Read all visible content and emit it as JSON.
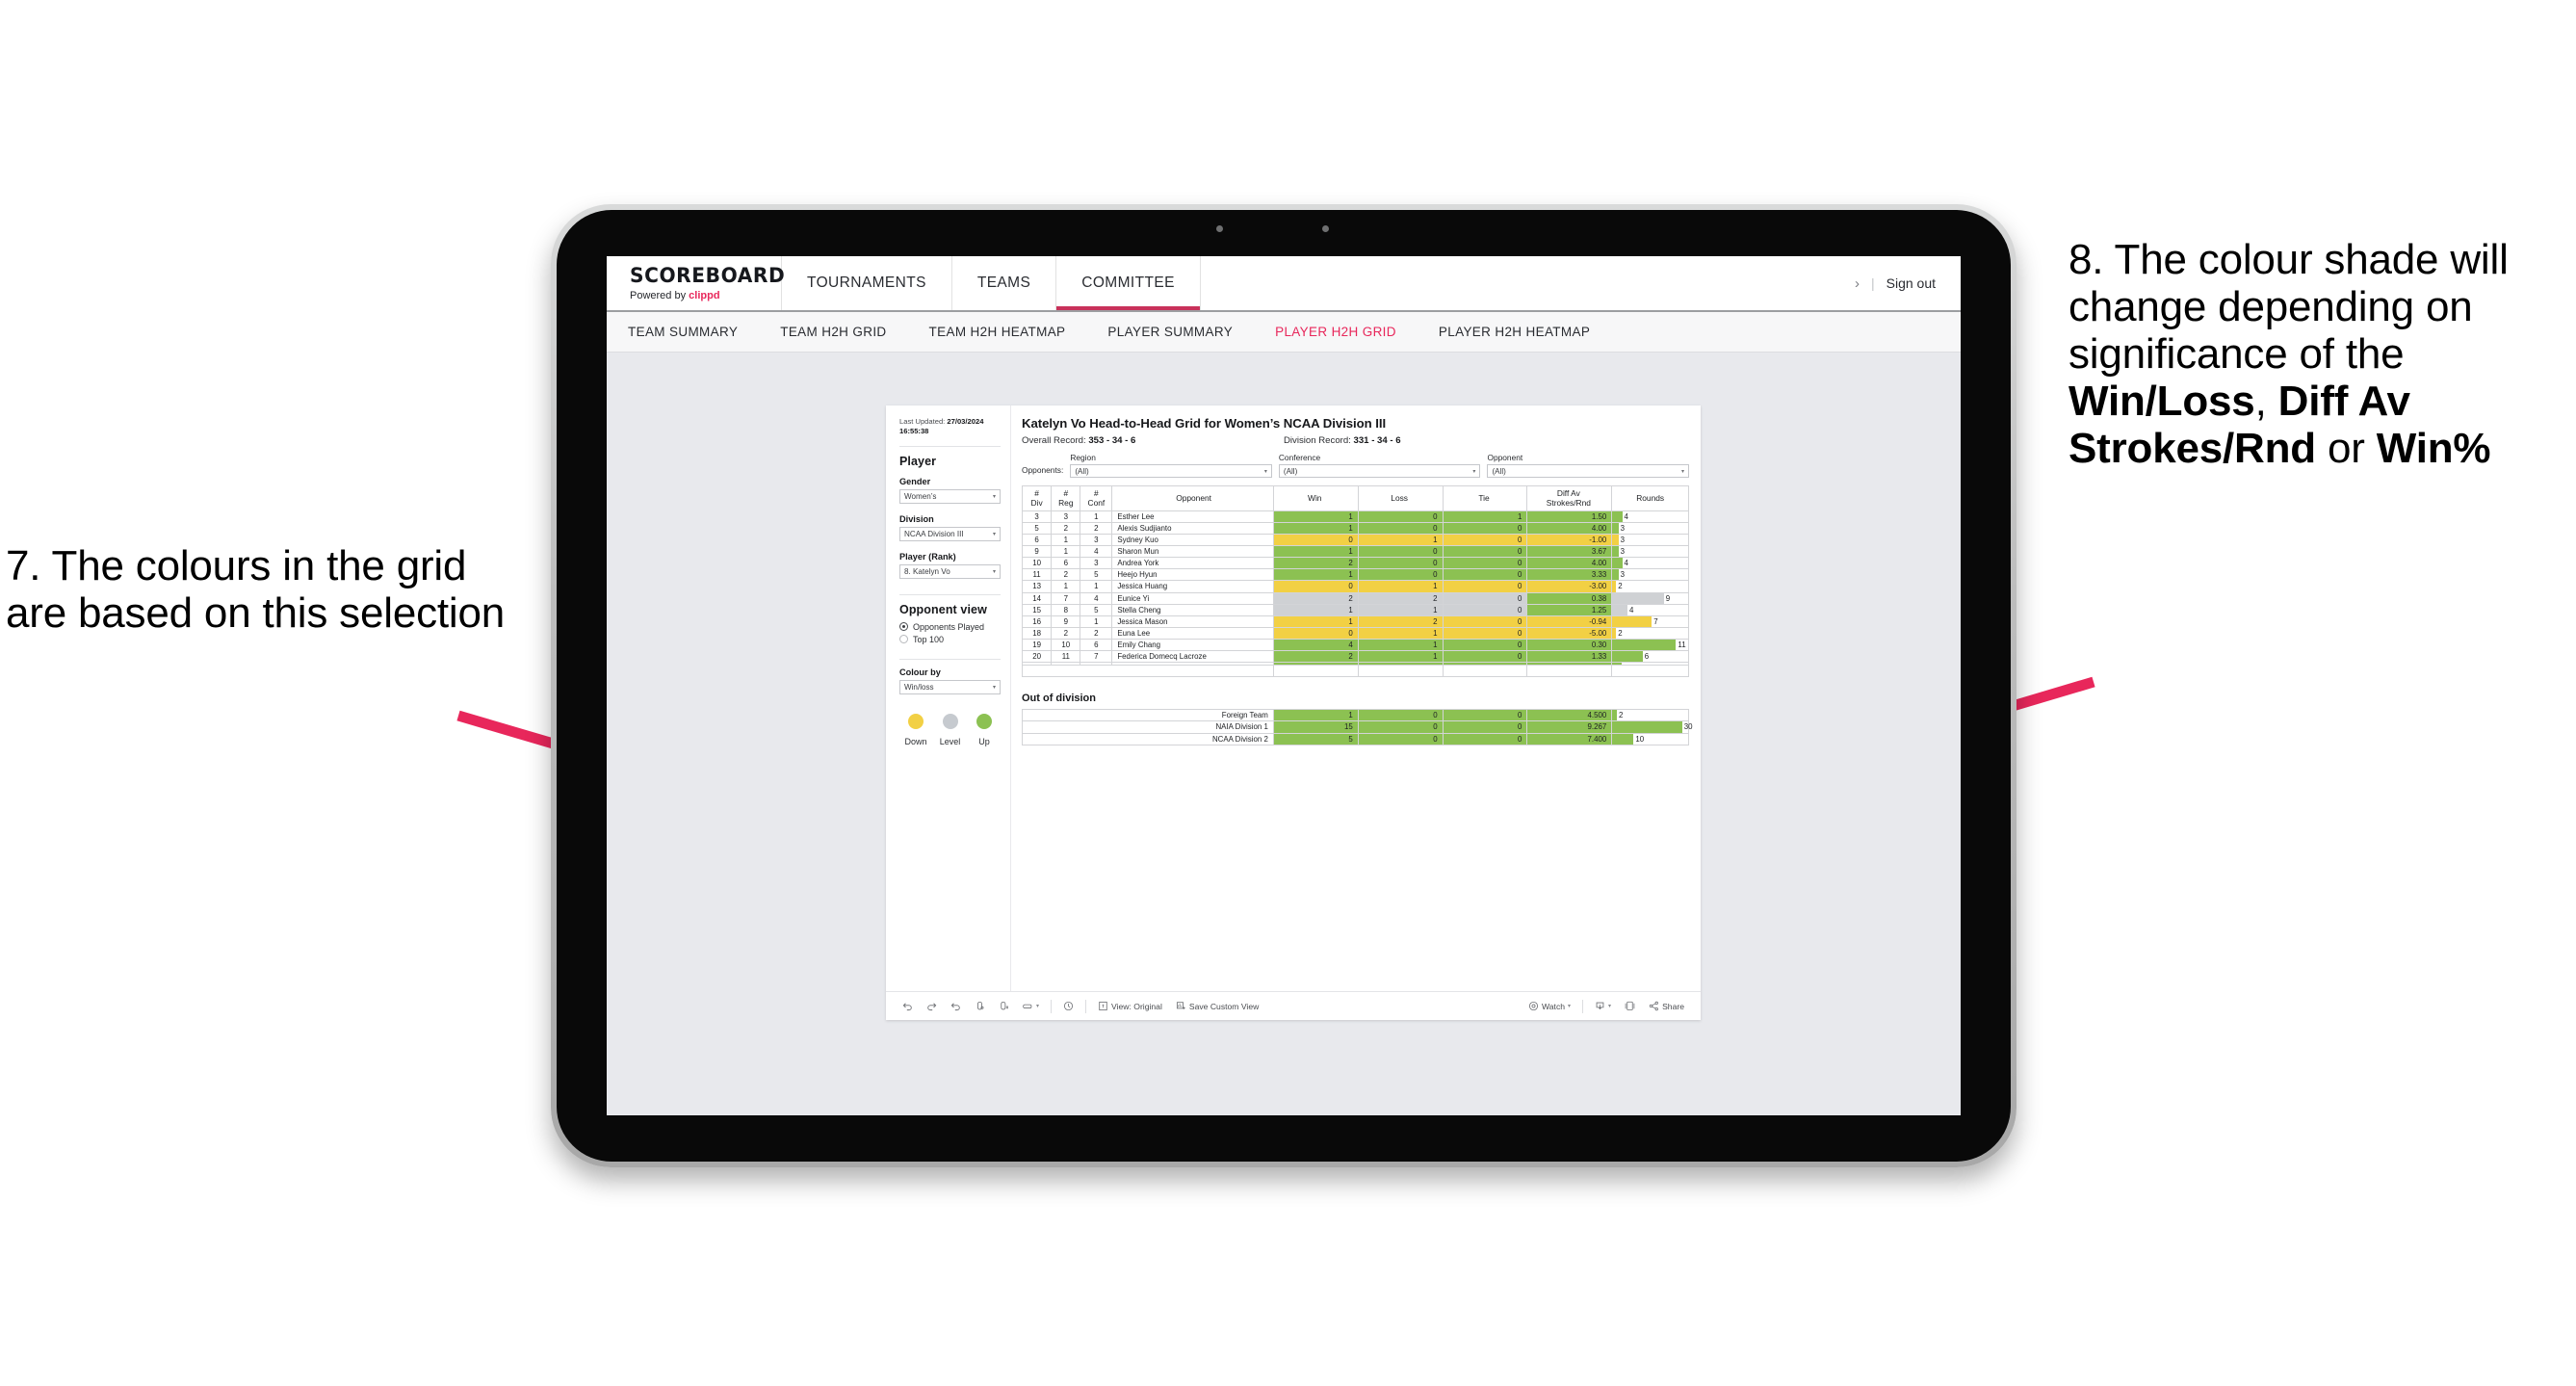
{
  "annotations": {
    "left": {
      "id": "anno-7",
      "text": "7. The colours in the grid are based on this selection"
    },
    "right": {
      "id": "anno-8",
      "prefix": "8. The colour shade will change depending on significance of the ",
      "bold1": "Win/Loss",
      "mid1": ", ",
      "bold2": "Diff Av Strokes/Rnd",
      "mid2": " or ",
      "bold3": "Win%"
    },
    "arrow_color": "#E8275B"
  },
  "appbar": {
    "brand_name": "SCOREBOARD",
    "brand_sub_prefix": "Powered by ",
    "brand_sub_link": "clippd",
    "nav": [
      {
        "label": "TOURNAMENTS",
        "active": false
      },
      {
        "label": "TEAMS",
        "active": false
      },
      {
        "label": "COMMITTEE",
        "active": true
      }
    ],
    "chevron": "›",
    "separator": "|",
    "sign_out": "Sign out"
  },
  "subnav": {
    "items": [
      {
        "label": "TEAM SUMMARY",
        "active": false
      },
      {
        "label": "TEAM H2H GRID",
        "active": false
      },
      {
        "label": "TEAM H2H HEATMAP",
        "active": false
      },
      {
        "label": "PLAYER SUMMARY",
        "active": false
      },
      {
        "label": "PLAYER H2H GRID",
        "active": true
      },
      {
        "label": "PLAYER H2H HEATMAP",
        "active": false
      }
    ],
    "active_color": "#E8275B"
  },
  "sidebar": {
    "last_updated_label": "Last Updated: ",
    "last_updated_value": "27/03/2024 16:55:38",
    "player_heading": "Player",
    "fields": [
      {
        "label": "Gender",
        "value": "Women’s"
      },
      {
        "label": "Division",
        "value": "NCAA Division III"
      },
      {
        "label": "Player (Rank)",
        "value": "8. Katelyn Vo"
      }
    ],
    "opponent_view_heading": "Opponent view",
    "opponent_view_options": [
      {
        "label": "Opponents Played",
        "selected": true
      },
      {
        "label": "Top 100",
        "selected": false
      }
    ],
    "colour_by_label": "Colour by",
    "colour_by_value": "Win/loss",
    "legend": [
      {
        "label": "Down",
        "color": "#F2D044"
      },
      {
        "label": "Level",
        "color": "#C6CACF"
      },
      {
        "label": "Up",
        "color": "#8CC152"
      }
    ],
    "caret": "▾"
  },
  "main": {
    "title": "Katelyn Vo Head-to-Head Grid for Women’s NCAA Division III",
    "overall_record_label": "Overall Record: ",
    "overall_record_value": "353 -  34 - 6",
    "division_record_label": "Division Record: ",
    "division_record_value": "331 -  34 - 6",
    "opponents_label": "Opponents:",
    "opponent_filters": [
      {
        "caption": "Region",
        "value": "(All)"
      },
      {
        "caption": "Conference",
        "value": "(All)"
      },
      {
        "caption": "Opponent",
        "value": "(All)"
      }
    ],
    "out_of_division_title": "Out of division"
  },
  "chart_data": {
    "type": "table",
    "title": "Katelyn Vo Head-to-Head Grid for Women’s NCAA Division III",
    "columns": [
      "# Div",
      "# Reg",
      "# Conf",
      "Opponent",
      "Win",
      "Loss",
      "Tie",
      "Diff Av Strokes/Rnd",
      "Rounds"
    ],
    "header_lines": [
      [
        "#",
        "Div"
      ],
      [
        "#",
        "Reg"
      ],
      [
        "#",
        "Conf"
      ],
      [
        "Opponent",
        ""
      ],
      [
        "Win",
        ""
      ],
      [
        "Loss",
        ""
      ],
      [
        "Tie",
        ""
      ],
      [
        "Diff Av",
        "Strokes/Rnd"
      ],
      [
        "Rounds",
        ""
      ]
    ],
    "rows": [
      {
        "div": "3",
        "reg": "3",
        "conf": "1",
        "opponent": "Esther Lee",
        "win": "1",
        "loss": "0",
        "tie": "1",
        "diff": "1.50",
        "rounds": "4",
        "shade": "up",
        "bar_pct": 13
      },
      {
        "div": "5",
        "reg": "2",
        "conf": "2",
        "opponent": "Alexis Sudjianto",
        "win": "1",
        "loss": "0",
        "tie": "0",
        "diff": "4.00",
        "rounds": "3",
        "shade": "up",
        "bar_pct": 8
      },
      {
        "div": "6",
        "reg": "1",
        "conf": "3",
        "opponent": "Sydney Kuo",
        "win": "0",
        "loss": "1",
        "tie": "0",
        "diff": "-1.00",
        "rounds": "3",
        "shade": "down",
        "bar_pct": 8
      },
      {
        "div": "9",
        "reg": "1",
        "conf": "4",
        "opponent": "Sharon Mun",
        "win": "1",
        "loss": "0",
        "tie": "0",
        "diff": "3.67",
        "rounds": "3",
        "shade": "up",
        "bar_pct": 8
      },
      {
        "div": "10",
        "reg": "6",
        "conf": "3",
        "opponent": "Andrea York",
        "win": "2",
        "loss": "0",
        "tie": "0",
        "diff": "4.00",
        "rounds": "4",
        "shade": "up",
        "bar_pct": 13
      },
      {
        "div": "11",
        "reg": "2",
        "conf": "5",
        "opponent": "Heejo Hyun",
        "win": "1",
        "loss": "0",
        "tie": "0",
        "diff": "3.33",
        "rounds": "3",
        "shade": "up",
        "bar_pct": 8
      },
      {
        "div": "13",
        "reg": "1",
        "conf": "1",
        "opponent": "Jessica Huang",
        "win": "0",
        "loss": "1",
        "tie": "0",
        "diff": "-3.00",
        "rounds": "2",
        "shade": "down",
        "bar_pct": 5
      },
      {
        "div": "14",
        "reg": "7",
        "conf": "4",
        "opponent": "Eunice Yi",
        "win": "2",
        "loss": "2",
        "tie": "0",
        "diff": "0.38",
        "rounds": "9",
        "shade": "level",
        "bar_pct": 68,
        "diff_shade": "up"
      },
      {
        "div": "15",
        "reg": "8",
        "conf": "5",
        "opponent": "Stella Cheng",
        "win": "1",
        "loss": "1",
        "tie": "0",
        "diff": "1.25",
        "rounds": "4",
        "shade": "level",
        "bar_pct": 20,
        "diff_shade": "up"
      },
      {
        "div": "16",
        "reg": "9",
        "conf": "1",
        "opponent": "Jessica Mason",
        "win": "1",
        "loss": "2",
        "tie": "0",
        "diff": "-0.94",
        "rounds": "7",
        "shade": "down",
        "bar_pct": 52
      },
      {
        "div": "18",
        "reg": "2",
        "conf": "2",
        "opponent": "Euna Lee",
        "win": "0",
        "loss": "1",
        "tie": "0",
        "diff": "-5.00",
        "rounds": "2",
        "shade": "down",
        "bar_pct": 5
      },
      {
        "div": "19",
        "reg": "10",
        "conf": "6",
        "opponent": "Emily Chang",
        "win": "4",
        "loss": "1",
        "tie": "0",
        "diff": "0.30",
        "rounds": "11",
        "shade": "up",
        "bar_pct": 84
      },
      {
        "div": "20",
        "reg": "11",
        "conf": "7",
        "opponent": "Federica Domecq Lacroze",
        "win": "2",
        "loss": "1",
        "tie": "0",
        "diff": "1.33",
        "rounds": "6",
        "shade": "up",
        "bar_pct": 40
      }
    ],
    "out_of_division": [
      {
        "name": "Foreign Team",
        "win": "1",
        "loss": "0",
        "tie": "0",
        "diff": "4.500",
        "rounds": "2",
        "shade": "up",
        "bar_pct": 6
      },
      {
        "name": "NAIA Division 1",
        "win": "15",
        "loss": "0",
        "tie": "0",
        "diff": "9.267",
        "rounds": "30",
        "shade": "up",
        "bar_pct": 92
      },
      {
        "name": "NCAA Division 2",
        "win": "5",
        "loss": "0",
        "tie": "0",
        "diff": "7.400",
        "rounds": "10",
        "shade": "up",
        "bar_pct": 28
      }
    ],
    "shade_colors": {
      "up": "#8CC152",
      "down": "#F2D044",
      "level": "#CFD1D4"
    }
  },
  "toolbar": {
    "items": [
      {
        "name": "undo-icon",
        "label": ""
      },
      {
        "name": "redo-icon",
        "label": ""
      },
      {
        "name": "revert-icon",
        "label": ""
      },
      {
        "name": "refresh-data-icon",
        "label": ""
      },
      {
        "name": "pause-refresh-icon",
        "label": ""
      },
      {
        "name": "highlighter-icon",
        "label": "",
        "caret": "▾"
      }
    ],
    "alerts_icon": "alerts-icon",
    "view_original": "View: Original",
    "save_custom_view": "Save Custom View",
    "watch": "Watch",
    "watch_caret": "▾",
    "download_caret": "▾",
    "share": "Share"
  }
}
